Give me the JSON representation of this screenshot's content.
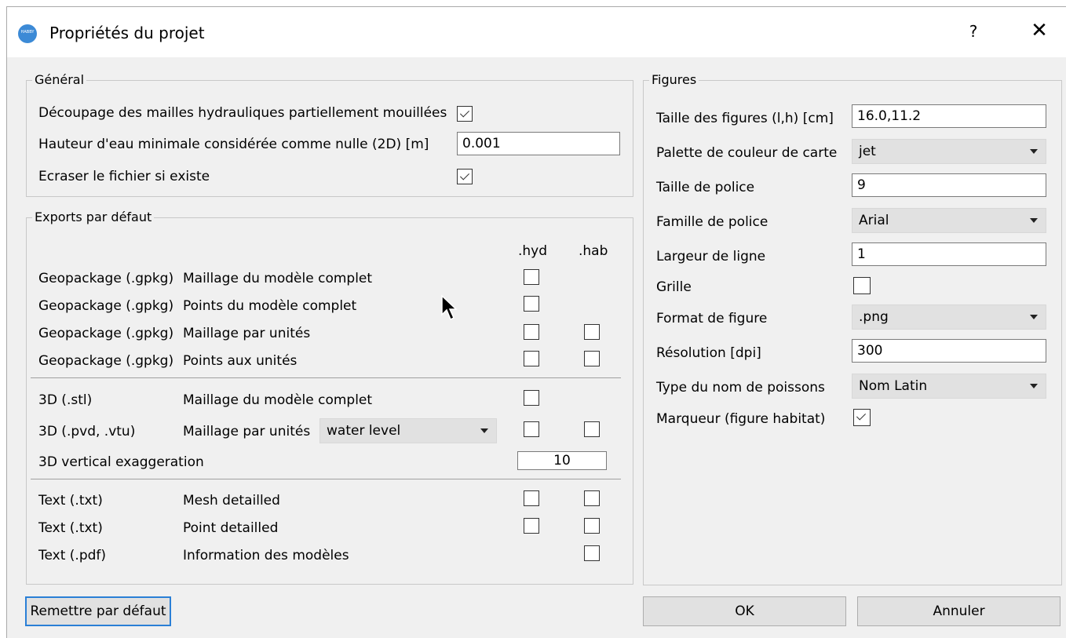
{
  "window": {
    "title": "Propriétés du projet",
    "logo_text": "HABBY",
    "help_label": "?",
    "close_label": "✕"
  },
  "general": {
    "title": "Général",
    "decoupage_label": "Découpage des mailles hydrauliques partiellement mouillées",
    "decoupage_checked": true,
    "hauteur_label": "Hauteur d'eau minimale considérée comme nulle (2D) [m]",
    "hauteur_value": "0.001",
    "ecraser_label": "Ecraser le fichier si existe",
    "ecraser_checked": true
  },
  "exports": {
    "title": "Exports par défaut",
    "col_hyd": ".hyd",
    "col_hab": ".hab",
    "rows": [
      {
        "format": "Geopackage (.gpkg)",
        "desc": "Maillage du modèle complet"
      },
      {
        "format": "Geopackage (.gpkg)",
        "desc": "Points du modèle complet"
      },
      {
        "format": "Geopackage (.gpkg)",
        "desc": "Maillage par unités"
      },
      {
        "format": "Geopackage (.gpkg)",
        "desc": "Points aux unités"
      },
      {
        "format": "3D (.stl)",
        "desc": "Maillage du modèle complet"
      },
      {
        "format": "3D (.pvd, .vtu)",
        "desc": "Maillage par unités",
        "combo": "water level"
      },
      {
        "format": "3D vertical exaggeration",
        "value": "10"
      },
      {
        "format": "Text (.txt)",
        "desc": "Mesh detailled"
      },
      {
        "format": "Text (.txt)",
        "desc": "Point detailled"
      },
      {
        "format": "Text (.pdf)",
        "desc": "Information des modèles"
      }
    ]
  },
  "figures": {
    "title": "Figures",
    "taille_label": "Taille des figures (l,h) [cm]",
    "taille_value": "16.0,11.2",
    "palette_label": "Palette de couleur de carte",
    "palette_value": "jet",
    "police_label": "Taille de police",
    "police_value": "9",
    "famille_label": "Famille de police",
    "famille_value": "Arial",
    "largeur_label": "Largeur de ligne",
    "largeur_value": "1",
    "grille_label": "Grille",
    "format_label": "Format de figure",
    "format_value": ".png",
    "resolution_label": "Résolution [dpi]",
    "resolution_value": "300",
    "type_label": "Type du nom de poissons",
    "type_value": "Nom Latin",
    "marqueur_label": "Marqueur (figure habitat)"
  },
  "buttons": {
    "reset": "Remettre par défaut",
    "ok": "OK",
    "cancel": "Annuler"
  },
  "colors": {
    "accent": "#2a7fd6",
    "logo": "#3c8ad6"
  }
}
